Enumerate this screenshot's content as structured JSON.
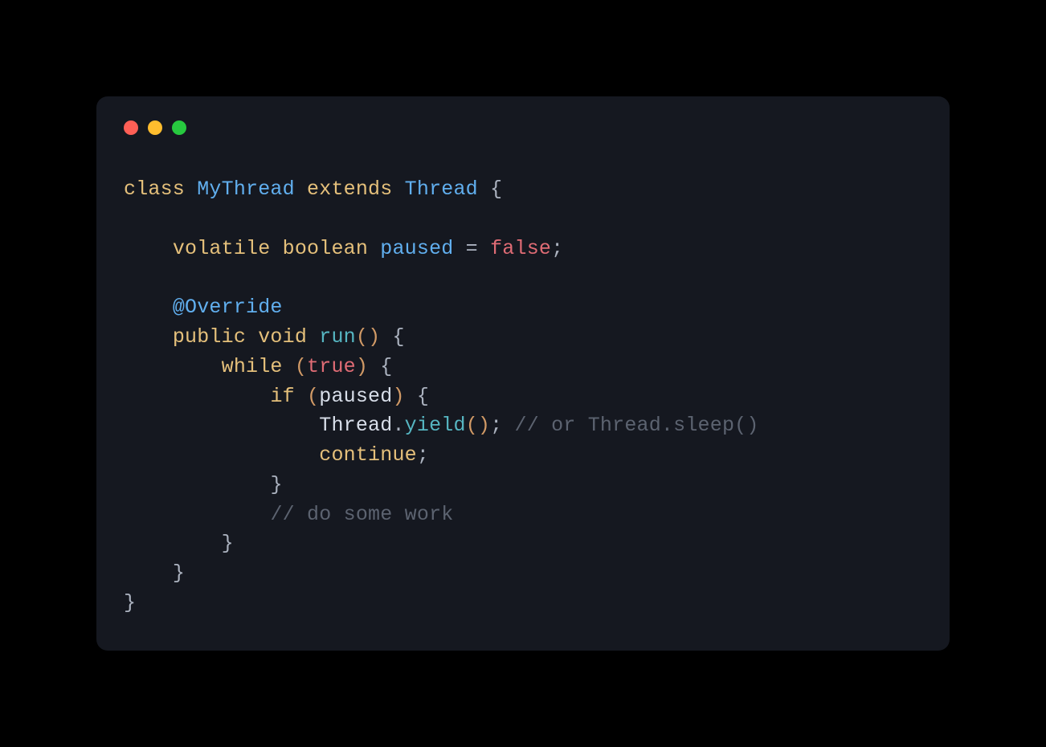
{
  "syntax": {
    "keywords": {
      "class": "class",
      "extends": "extends",
      "volatile": "volatile",
      "boolean": "boolean",
      "public": "public",
      "void": "void",
      "while": "while",
      "if": "if",
      "continue": "continue"
    },
    "types": {
      "MyThread": "MyThread",
      "Thread": "Thread"
    },
    "identifiers": {
      "paused": "paused",
      "yield": "yield"
    },
    "annotations": {
      "Override": "@Override"
    },
    "funcs": {
      "run": "run"
    },
    "literals": {
      "false": "false",
      "true": "true"
    },
    "comments": {
      "yield": "// or Thread.sleep()",
      "work": "// do some work"
    },
    "punct": {
      "assign": " = ",
      "lbrace": "{",
      "rbrace": "}",
      "lparen": "(",
      "rparen": ")",
      "semi": ";",
      "dot": "."
    }
  },
  "window": {
    "controls": {
      "close": "close",
      "minimize": "minimize",
      "maximize": "maximize"
    }
  }
}
